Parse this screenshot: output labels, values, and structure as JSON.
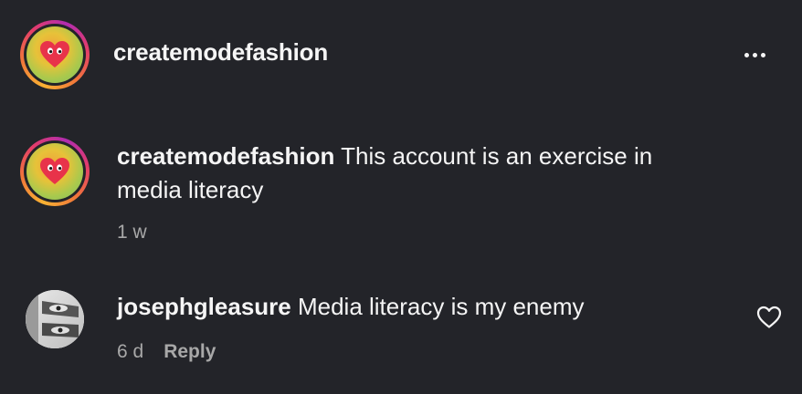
{
  "header": {
    "username": "createmodefashion",
    "more_icon": "more-horizontal-icon"
  },
  "caption": {
    "username": "createmodefashion",
    "text": " This account is an exercise in",
    "text_line2": "media literacy",
    "time": "1 w"
  },
  "comments": [
    {
      "username": "josephgleasure",
      "text": " Media literacy is my enemy",
      "time": "6 d",
      "reply_label": "Reply",
      "like_icon": "heart-outline-icon"
    }
  ],
  "colors": {
    "background": "#232429",
    "text_primary": "#f5f5f5",
    "text_secondary": "#a8a8a8"
  }
}
